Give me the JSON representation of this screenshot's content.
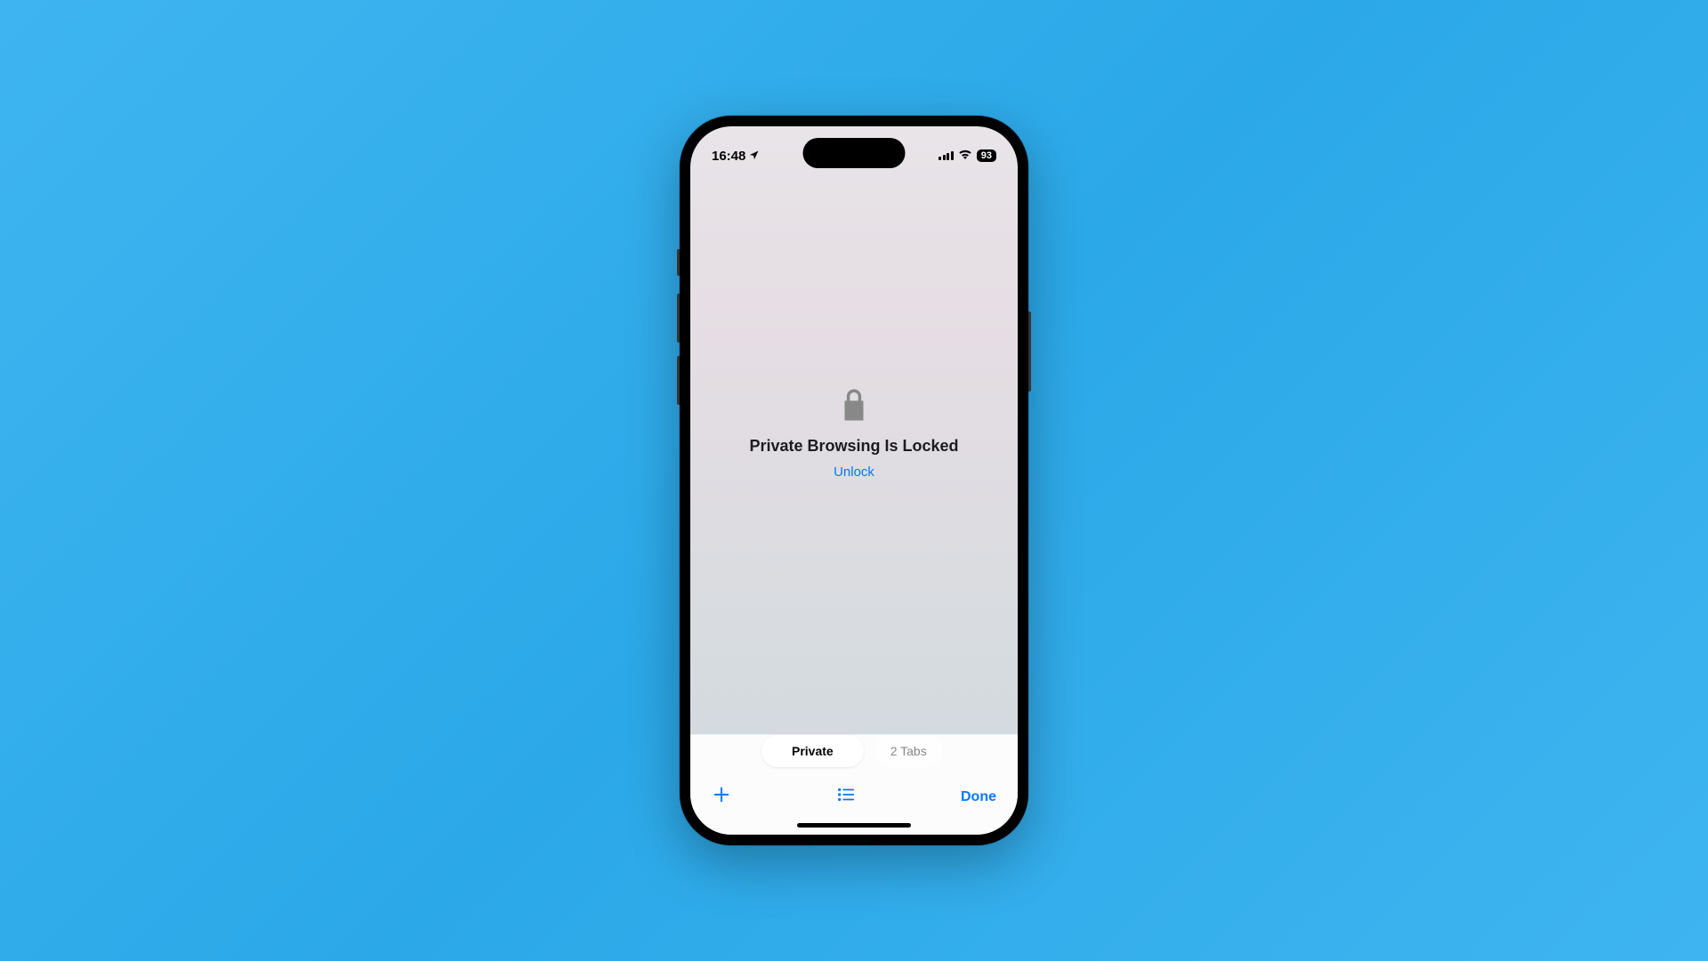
{
  "statusBar": {
    "time": "16:48",
    "battery": "93"
  },
  "main": {
    "title": "Private Browsing Is Locked",
    "unlockLabel": "Unlock"
  },
  "tabSelector": {
    "active": "Private",
    "inactive": "2 Tabs"
  },
  "toolbar": {
    "doneLabel": "Done"
  }
}
